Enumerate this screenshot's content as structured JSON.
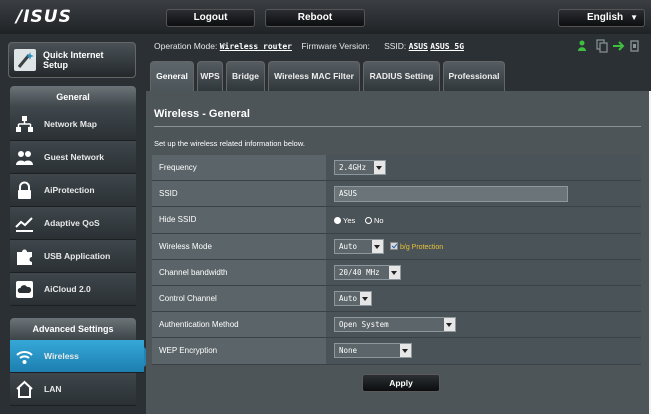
{
  "brand": "/ISUS",
  "header": {
    "logout": "Logout",
    "reboot": "Reboot",
    "language": "English"
  },
  "sidebar": {
    "qis_label": "Quick Internet\nSetup",
    "general_title": "General",
    "general_items": [
      {
        "label": "Network Map",
        "icon": "network-map-icon"
      },
      {
        "label": "Guest Network",
        "icon": "guest-network-icon"
      },
      {
        "label": "AiProtection",
        "icon": "lock-icon"
      },
      {
        "label": "Adaptive QoS",
        "icon": "qos-icon"
      },
      {
        "label": "USB Application",
        "icon": "puzzle-icon"
      },
      {
        "label": "AiCloud 2.0",
        "icon": "cloud-icon"
      }
    ],
    "advanced_title": "Advanced Settings",
    "advanced_items": [
      {
        "label": "Wireless",
        "icon": "wifi-icon",
        "active": true
      },
      {
        "label": "LAN",
        "icon": "home-icon"
      }
    ]
  },
  "status": {
    "op_mode_label": "Operation Mode:",
    "op_mode_value": "Wireless router",
    "fw_label": "Firmware Version:",
    "ssid_label": "SSID:",
    "ssid_1": "ASUS",
    "ssid_2": "ASUS_5G"
  },
  "tabs": [
    "General",
    "WPS",
    "Bridge",
    "Wireless MAC Filter",
    "RADIUS Setting",
    "Professional"
  ],
  "panel": {
    "title": "Wireless - General",
    "description": "Set up the wireless related information below."
  },
  "settings": {
    "frequency": {
      "label": "Frequency",
      "value": "2.4GHz"
    },
    "ssid": {
      "label": "SSID",
      "value": "ASUS"
    },
    "hide_ssid": {
      "label": "Hide SSID",
      "yes": "Yes",
      "no": "No",
      "selected": "Yes"
    },
    "wireless_mode": {
      "label": "Wireless Mode",
      "value": "Auto",
      "protection": "b/g Protection"
    },
    "channel_bandwidth": {
      "label": "Channel bandwidth",
      "value": "20/40 MHz"
    },
    "control_channel": {
      "label": "Control Channel",
      "value": "Auto"
    },
    "auth_method": {
      "label": "Authentication Method",
      "value": "Open System"
    },
    "wep": {
      "label": "WEP Encryption",
      "value": "None"
    }
  },
  "apply_label": "Apply",
  "colors": {
    "accent": "#2a93c6",
    "panel": "#4d5559",
    "sidebar": "#2b3034",
    "warning": "#e7c33a"
  }
}
